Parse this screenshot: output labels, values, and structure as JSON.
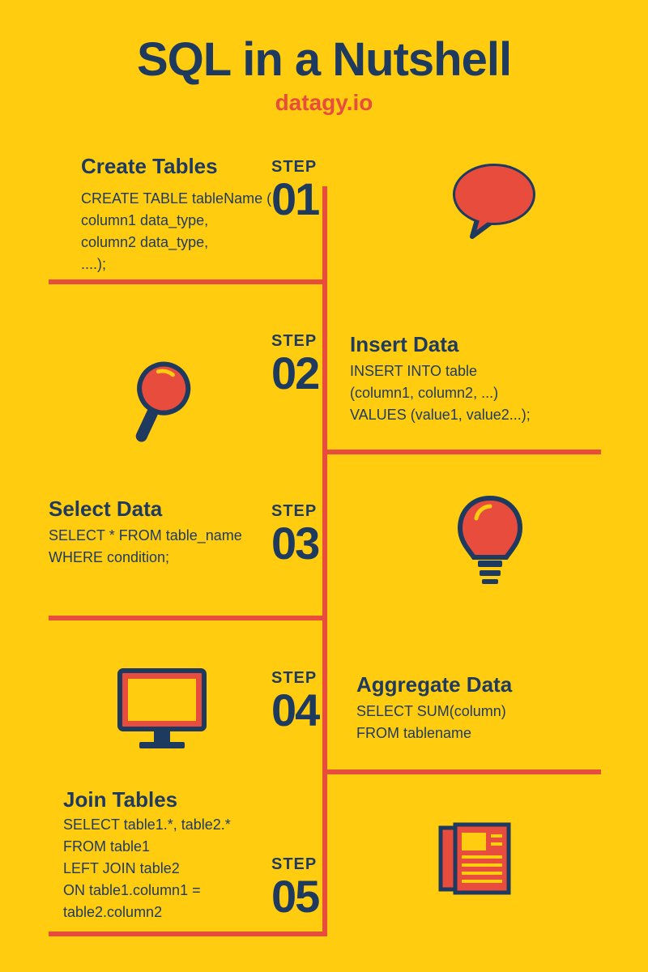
{
  "header": {
    "title": "SQL in a Nutshell",
    "subtitle": "datagy.io"
  },
  "colors": {
    "background": "#FFCC10",
    "navy": "#1E3A5F",
    "orange": "#E84C3D"
  },
  "steps": [
    {
      "label": "STEP",
      "number": "01",
      "title": "Create  Tables",
      "body": "CREATE TABLE tableName (\n      column1 data_type,\n      column2 data_type,\n      ....);",
      "icon": "speech-bubble-icon"
    },
    {
      "label": "STEP",
      "number": "02",
      "title": "Insert Data",
      "body": "INSERT INTO table\n(column1, column2, ...)\nVALUES (value1, value2...);",
      "icon": "magnifier-icon"
    },
    {
      "label": "STEP",
      "number": "03",
      "title": "Select Data",
      "body": "SELECT * FROM table_name\nWHERE condition;",
      "icon": "lightbulb-icon"
    },
    {
      "label": "STEP",
      "number": "04",
      "title": "Aggregate Data",
      "body": "SELECT SUM(column)\nFROM tablename",
      "icon": "monitor-icon"
    },
    {
      "label": "STEP",
      "number": "05",
      "title": "Join Tables",
      "body": "SELECT table1.*, table2.*\nFROM table1\nLEFT JOIN table2\nON table1.column1 =\ntable2.column2",
      "icon": "newspaper-icon"
    }
  ]
}
